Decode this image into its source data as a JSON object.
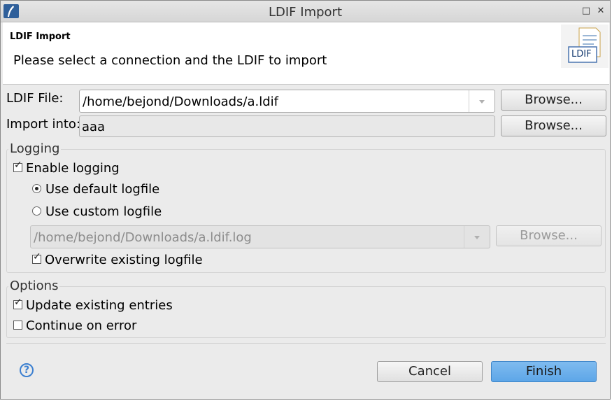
{
  "window": {
    "title": "LDIF Import",
    "maximize_icon": "maximize-icon",
    "close_icon": "close-icon"
  },
  "header": {
    "title": "LDIF Import",
    "message": "Please select a connection and the LDIF to import",
    "image_badge": "LDIF"
  },
  "form": {
    "ldif_file_label": "LDIF File:",
    "ldif_file_value": "/home/bejond/Downloads/a.ldif",
    "import_into_label": "Import into:",
    "import_into_value": "aaa",
    "browse_label": "Browse..."
  },
  "logging": {
    "title": "Logging",
    "enable_logging": "Enable logging",
    "use_default": "Use default logfile",
    "use_custom": "Use custom logfile",
    "logfile_value": "/home/bejond/Downloads/a.ldif.log",
    "browse_label": "Browse...",
    "overwrite": "Overwrite existing logfile"
  },
  "options": {
    "title": "Options",
    "update_existing": "Update existing entries",
    "continue_on_error": "Continue on error"
  },
  "footer": {
    "help": "?",
    "cancel": "Cancel",
    "finish": "Finish"
  },
  "colors": {
    "primary_button": "#5da6e8",
    "help_icon": "#3b7fd0"
  }
}
